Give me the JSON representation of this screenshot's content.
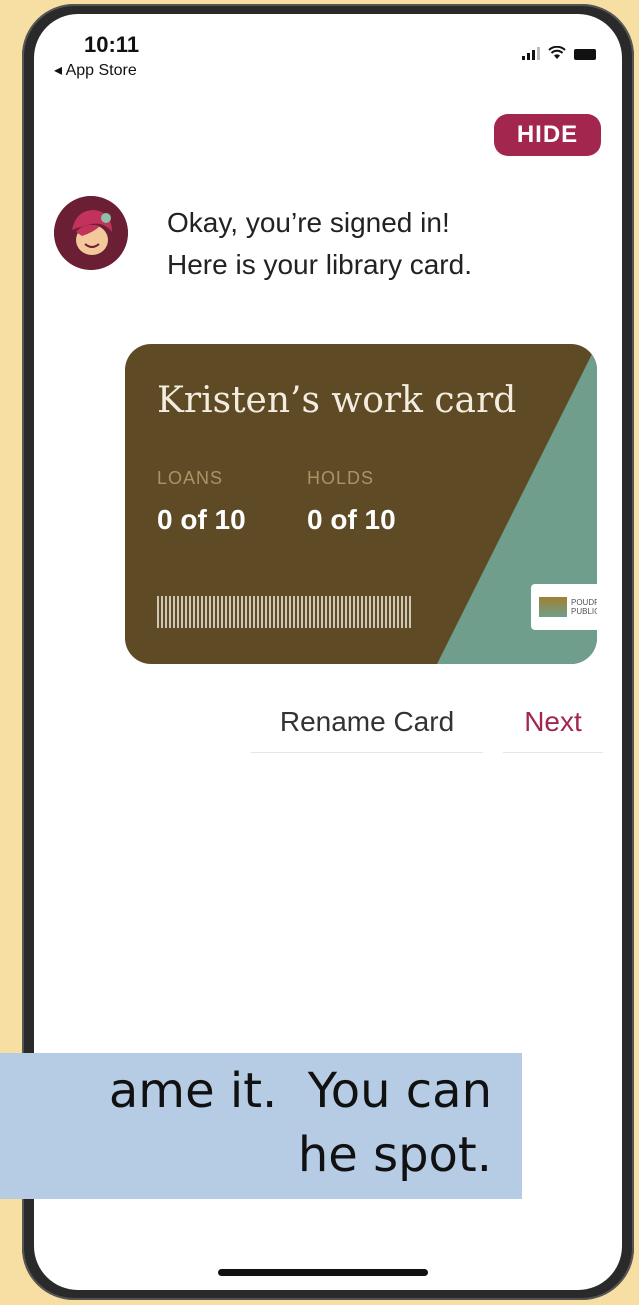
{
  "status_bar": {
    "time": "10:11",
    "back_label": "◂ App Store"
  },
  "hide_button": {
    "label": "HIDE"
  },
  "message": {
    "line1": "Okay, you’re signed in!",
    "line2": "Here is your library card."
  },
  "card": {
    "title": "Kristen’s work card",
    "loans_label": "LOANS",
    "loans_value": "0 of 10",
    "holds_label": "HOLDS",
    "holds_value": "0 of 10",
    "colors": {
      "card": "#5e4a25",
      "accent": "#6f9e8c"
    }
  },
  "actions": {
    "rename_label": "Rename Card",
    "next_label": "Next"
  },
  "caption": {
    "line1": "ame it.  You can",
    "line2": "he spot."
  },
  "colors": {
    "brand": "#a3264e",
    "caption_bg": "#b6cce4",
    "page_bg": "#f7dfa3"
  }
}
